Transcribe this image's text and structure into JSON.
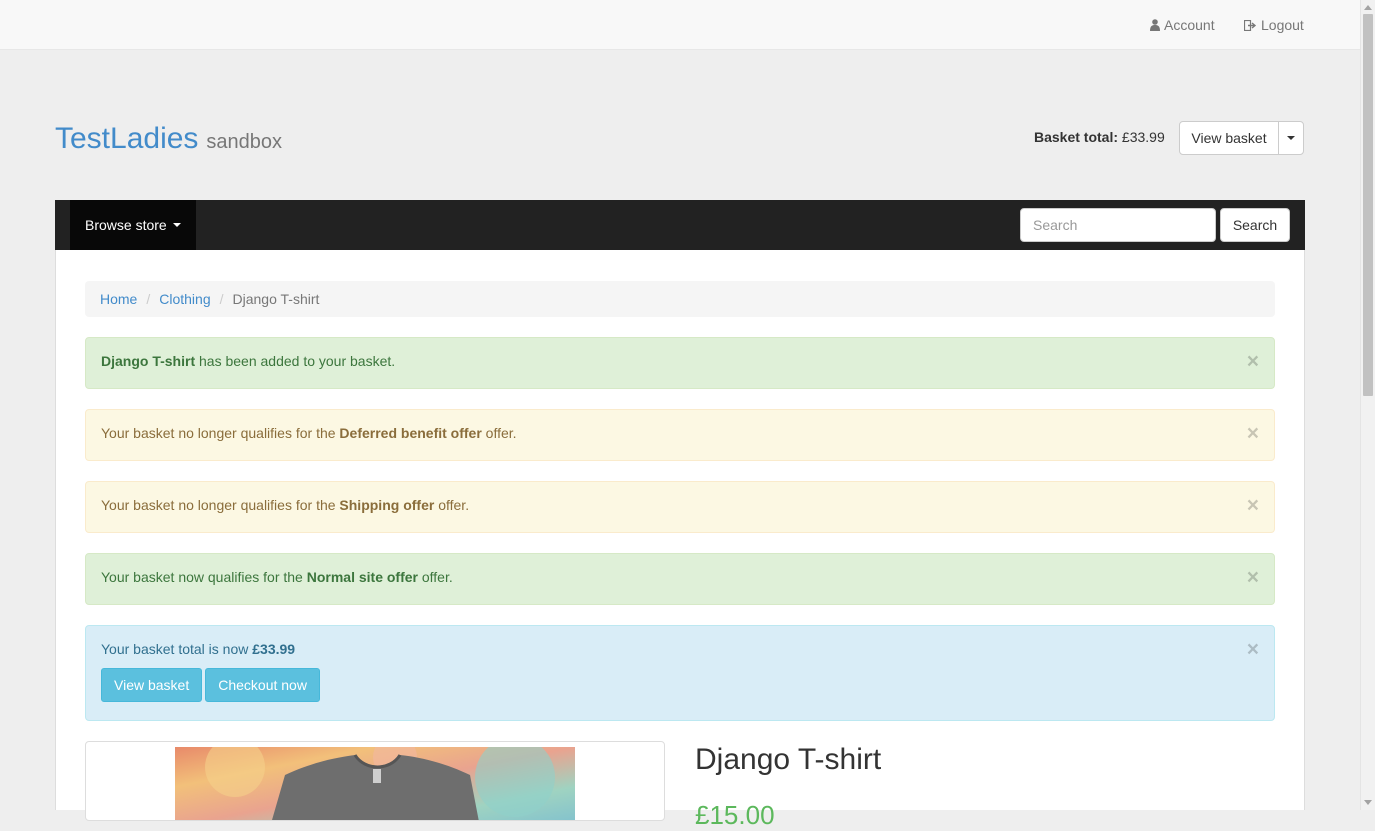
{
  "topbar": {
    "account": "Account",
    "logout": "Logout"
  },
  "header": {
    "brand_name": "TestLadies",
    "brand_sub": "sandbox",
    "basket_total_label": "Basket total:",
    "basket_total_value": "£33.99",
    "view_basket": "View basket"
  },
  "navbar": {
    "browse_store": "Browse store",
    "search_placeholder": "Search",
    "search_button": "Search"
  },
  "breadcrumb": {
    "items": [
      "Home",
      "Clothing"
    ],
    "active": "Django T-shirt"
  },
  "alerts": {
    "added": {
      "strong": "Django T-shirt",
      "text": " has been added to your basket."
    },
    "deferred": {
      "pre": "Your basket no longer qualifies for the ",
      "strong": "Deferred benefit offer",
      "post": " offer."
    },
    "shipping": {
      "pre": "Your basket no longer qualifies for the ",
      "strong": "Shipping offer",
      "post": " offer."
    },
    "normal": {
      "pre": "Your basket now qualifies for the ",
      "strong": "Normal site offer",
      "post": " offer."
    },
    "total": {
      "pre": "Your basket total is now ",
      "strong": "£33.99",
      "view_basket": "View basket",
      "checkout": "Checkout now"
    },
    "close_glyph": "×"
  },
  "product": {
    "title": "Django T-shirt",
    "price": "£15.00"
  },
  "colors": {
    "brand": "#428bca",
    "navbar": "#222222",
    "success_bg": "#dff0d8",
    "warning_bg": "#fcf8e3",
    "info_bg": "#d9edf7"
  }
}
